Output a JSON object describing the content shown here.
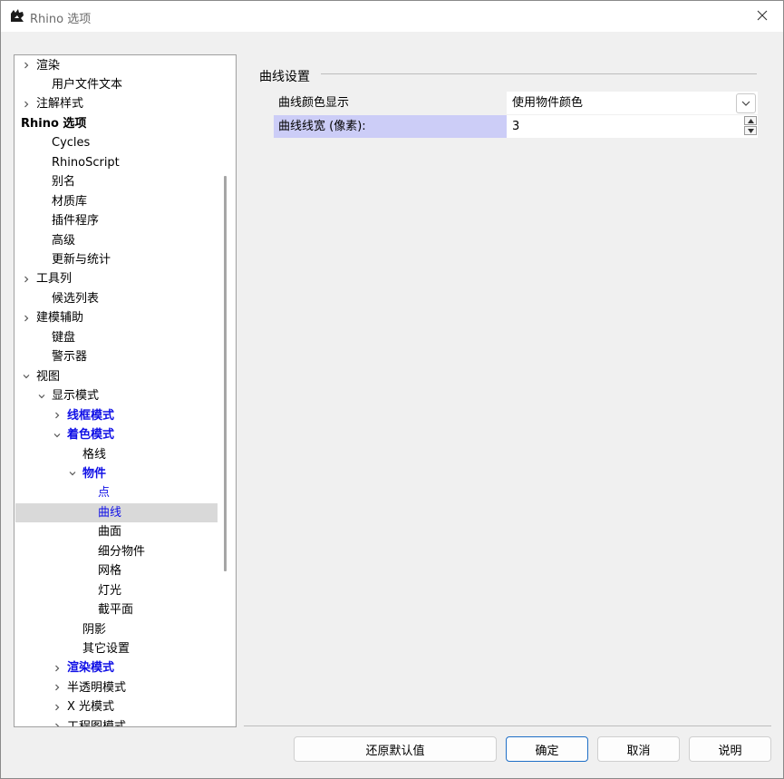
{
  "window": {
    "title": "Rhino 选项"
  },
  "tree": {
    "items": [
      {
        "label": "渲染",
        "expander": "collapsed",
        "style": "normal"
      },
      {
        "label": "用户文件文本",
        "expander": "none",
        "style": "normal"
      },
      {
        "label": "注解样式",
        "expander": "collapsed",
        "style": "normal"
      },
      {
        "label": "Rhino 选项",
        "expander": "none",
        "style": "bold"
      },
      {
        "label": "Cycles",
        "expander": "none",
        "style": "normal"
      },
      {
        "label": "RhinoScript",
        "expander": "none",
        "style": "normal"
      },
      {
        "label": "别名",
        "expander": "none",
        "style": "normal"
      },
      {
        "label": "材质库",
        "expander": "none",
        "style": "normal"
      },
      {
        "label": "插件程序",
        "expander": "none",
        "style": "normal"
      },
      {
        "label": "高级",
        "expander": "none",
        "style": "normal"
      },
      {
        "label": "更新与统计",
        "expander": "none",
        "style": "normal"
      },
      {
        "label": "工具列",
        "expander": "collapsed",
        "style": "normal"
      },
      {
        "label": "候选列表",
        "expander": "none",
        "style": "normal"
      },
      {
        "label": "建模辅助",
        "expander": "collapsed",
        "style": "normal"
      },
      {
        "label": "键盘",
        "expander": "none",
        "style": "normal"
      },
      {
        "label": "警示器",
        "expander": "none",
        "style": "normal"
      },
      {
        "label": "视图",
        "expander": "expanded",
        "style": "normal"
      },
      {
        "label": "显示模式",
        "expander": "expanded",
        "style": "normal"
      },
      {
        "label": "线框模式",
        "expander": "collapsed",
        "style": "blue"
      },
      {
        "label": "着色模式",
        "expander": "expanded",
        "style": "blue"
      },
      {
        "label": "格线",
        "expander": "none",
        "style": "normal"
      },
      {
        "label": "物件",
        "expander": "expanded",
        "style": "blue"
      },
      {
        "label": "点",
        "expander": "none",
        "style": "blue-plain"
      },
      {
        "label": "曲线",
        "expander": "none",
        "style": "blue-plain",
        "selected": true
      },
      {
        "label": "曲面",
        "expander": "none",
        "style": "normal"
      },
      {
        "label": "细分物件",
        "expander": "none",
        "style": "normal"
      },
      {
        "label": "网格",
        "expander": "none",
        "style": "normal"
      },
      {
        "label": "灯光",
        "expander": "none",
        "style": "normal"
      },
      {
        "label": "截平面",
        "expander": "none",
        "style": "normal"
      },
      {
        "label": "阴影",
        "expander": "none",
        "style": "normal"
      },
      {
        "label": "其它设置",
        "expander": "none",
        "style": "normal"
      },
      {
        "label": "渲染模式",
        "expander": "collapsed",
        "style": "blue"
      },
      {
        "label": "半透明模式",
        "expander": "collapsed",
        "style": "normal"
      },
      {
        "label": "X 光模式",
        "expander": "collapsed",
        "style": "normal"
      },
      {
        "label": "工程图模式",
        "expander": "collapsed",
        "style": "normal"
      }
    ]
  },
  "section": {
    "title": "曲线设置",
    "color_label": "曲线颜色显示",
    "color_value": "使用物件颜色",
    "width_label": "曲线线宽 (像素):",
    "width_value": "3"
  },
  "buttons": {
    "restore": "还原默认值",
    "ok": "确定",
    "cancel": "取消",
    "help": "说明"
  },
  "colors": {
    "accent_blue_text": "#1010e6",
    "highlight_label": "#cccdf7",
    "selected_row": "#d9d9d9",
    "primary_button_border": "#1f6fc7"
  }
}
